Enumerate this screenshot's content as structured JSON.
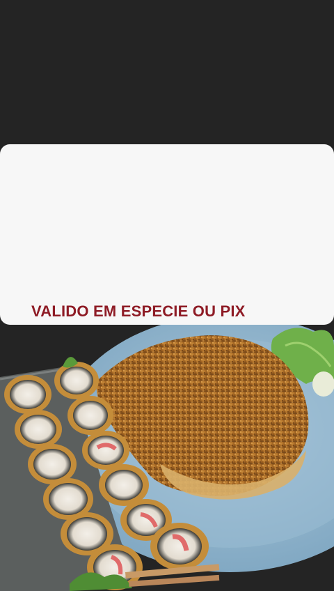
{
  "promo": {
    "text": "VALIDO EM ESPECIE OU PIX",
    "text_color": "#8e1b25",
    "card_color": "#f7f7f7"
  },
  "background_color": "#242424",
  "photo": {
    "subject": "fried sushi rolls and breaded fried dish on blue plate"
  }
}
